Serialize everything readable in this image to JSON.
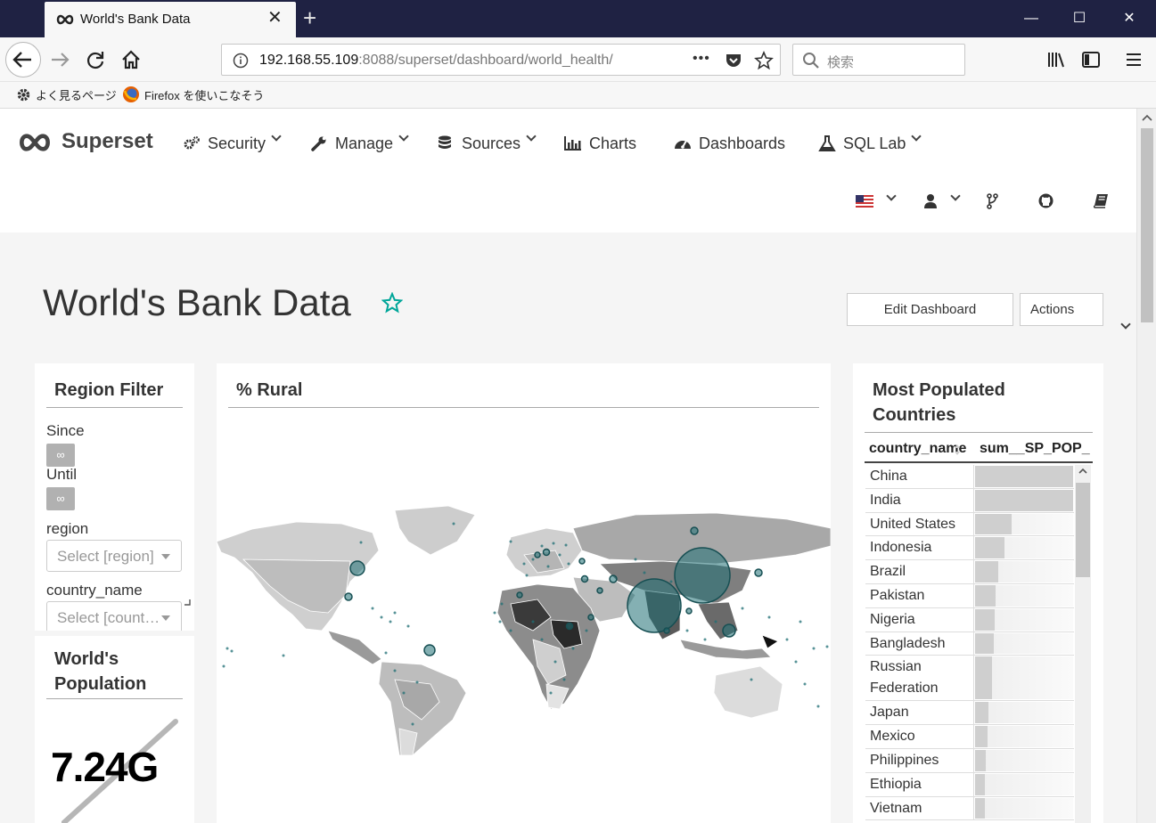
{
  "browser": {
    "tab_title": "World's Bank Data",
    "url_host": "192.168.55.109",
    "url_rest": ":8088/superset/dashboard/world_health/",
    "search_placeholder": "検索",
    "bookmarks": [
      "よく見るページ",
      "Firefox を使いこなそう"
    ],
    "more_icon_label": "•••"
  },
  "nav": {
    "brand": "Superset",
    "items": [
      {
        "label": "Security",
        "icon": "gears-icon",
        "dropdown": true
      },
      {
        "label": "Manage",
        "icon": "wrench-icon",
        "dropdown": true
      },
      {
        "label": "Sources",
        "icon": "database-icon",
        "dropdown": true
      },
      {
        "label": "Charts",
        "icon": "bar-chart-icon",
        "dropdown": false
      },
      {
        "label": "Dashboards",
        "icon": "dashboard-icon",
        "dropdown": false
      },
      {
        "label": "SQL Lab",
        "icon": "flask-icon",
        "dropdown": true
      }
    ],
    "right_icons": [
      "us-flag-icon",
      "user-icon",
      "code-fork-icon",
      "github-icon",
      "book-icon"
    ]
  },
  "dashboard": {
    "title": "World's Bank Data",
    "edit_button": "Edit Dashboard",
    "actions_button": "Actions"
  },
  "region_filter": {
    "title": "Region Filter",
    "since_label": "Since",
    "since_value": "∞",
    "until_label": "Until",
    "until_value": "∞",
    "region_label": "region",
    "region_placeholder": "Select [region]",
    "country_label": "country_name",
    "country_placeholder": "Select [country_name]"
  },
  "world_population": {
    "title_line1": "World's",
    "title_line2": "Population",
    "value": "7.24G"
  },
  "rural_map": {
    "title": "% Rural"
  },
  "populated": {
    "title_line1": "Most Populated",
    "title_line2": "Countries",
    "columns": [
      "country_name",
      "sum__SP_POP_"
    ],
    "rows": [
      {
        "name": "China",
        "value": 1.0
      },
      {
        "name": "India",
        "value": 1.0
      },
      {
        "name": "United States",
        "value": 0.37
      },
      {
        "name": "Indonesia",
        "value": 0.3
      },
      {
        "name": "Brazil",
        "value": 0.24
      },
      {
        "name": "Pakistan",
        "value": 0.21
      },
      {
        "name": "Nigeria",
        "value": 0.2
      },
      {
        "name": "Bangladesh",
        "value": 0.19
      },
      {
        "name": "Russian Federation",
        "value": 0.17
      },
      {
        "name": "Japan",
        "value": 0.14
      },
      {
        "name": "Mexico",
        "value": 0.13
      },
      {
        "name": "Philippines",
        "value": 0.11
      },
      {
        "name": "Ethiopia",
        "value": 0.1
      },
      {
        "name": "Vietnam",
        "value": 0.1
      }
    ]
  }
}
